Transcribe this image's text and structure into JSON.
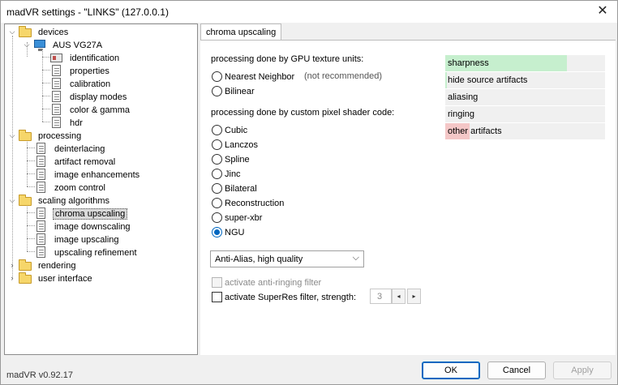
{
  "window": {
    "title": "madVR settings - \"LINKS\" (127.0.0.1)",
    "version": "madVR v0.92.17"
  },
  "tree": {
    "devices": "devices",
    "device": "AUS VG27A",
    "identification": "identification",
    "properties": "properties",
    "calibration": "calibration",
    "display_modes": "display modes",
    "color_gamma": "color & gamma",
    "hdr": "hdr",
    "processing": "processing",
    "deinterlacing": "deinterlacing",
    "artifact_removal": "artifact removal",
    "image_enhancements": "image enhancements",
    "zoom_control": "zoom control",
    "scaling_algorithms": "scaling algorithms",
    "chroma_upscaling": "chroma upscaling",
    "image_downscaling": "image downscaling",
    "image_upscaling": "image upscaling",
    "upscaling_refinement": "upscaling refinement",
    "rendering": "rendering",
    "user_interface": "user interface"
  },
  "tab": {
    "label": "chroma upscaling"
  },
  "gpu": {
    "heading": "processing done by GPU texture units:",
    "nearest": "Nearest Neighbor",
    "nearest_note": "(not recommended)",
    "bilinear": "Bilinear"
  },
  "shader": {
    "heading": "processing done by custom pixel shader code:",
    "options": [
      "Cubic",
      "Lanczos",
      "Spline",
      "Jinc",
      "Bilateral",
      "Reconstruction",
      "super-xbr",
      "NGU"
    ],
    "selected": "NGU"
  },
  "quality": {
    "value": "Anti-Alias, high quality"
  },
  "options": {
    "anti_ringing": "activate anti-ringing filter",
    "superres": "activate SuperRes filter, strength:",
    "strength": "3"
  },
  "bars": [
    {
      "label": "sharpness",
      "fill": 0.76,
      "color": "#c6efce"
    },
    {
      "label": "hide source artifacts",
      "fill": 0.01,
      "color": "#c6efce"
    },
    {
      "label": "aliasing",
      "fill": 0,
      "color": "#c6efce"
    },
    {
      "label": "ringing",
      "fill": 0,
      "color": "#c6efce"
    },
    {
      "label": "other artifacts",
      "fill": 0.15,
      "color": "#f4c7c7"
    }
  ],
  "buttons": {
    "ok": "OK",
    "cancel": "Cancel",
    "apply": "Apply"
  },
  "icons": {
    "close": "close-icon",
    "folder": "folder-icon",
    "monitor": "monitor-icon",
    "doc": "document-icon"
  }
}
